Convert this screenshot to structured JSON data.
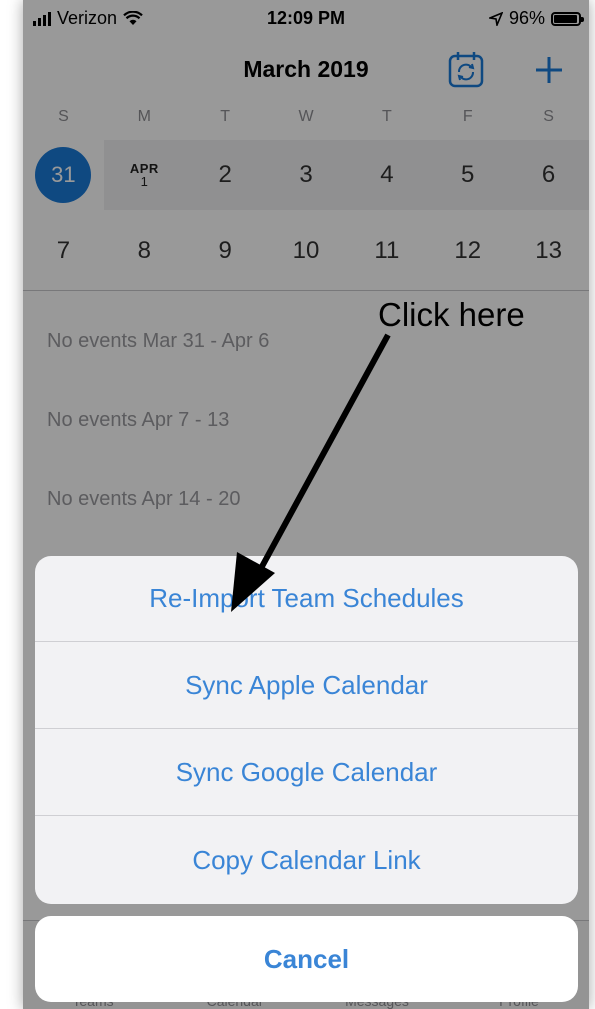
{
  "status_bar": {
    "carrier": "Verizon",
    "time": "12:09 PM",
    "battery": "96%",
    "battery_level": 0.96
  },
  "header": {
    "title": "March 2019",
    "calendar_sync_icon": "calendar-sync-icon",
    "add_icon": "plus-icon"
  },
  "weekdays": [
    "S",
    "M",
    "T",
    "W",
    "T",
    "F",
    "S"
  ],
  "week1": {
    "selected_day": "31",
    "apr_month": "APR",
    "apr_day": "1",
    "days": [
      "2",
      "3",
      "4",
      "5",
      "6"
    ]
  },
  "week2": [
    "7",
    "8",
    "9",
    "10",
    "11",
    "12",
    "13"
  ],
  "events": [
    "No events Mar 31 - Apr 6",
    "No events Apr 7 - 13",
    "No events Apr 14 - 20"
  ],
  "tabs": [
    "Teams",
    "Calendar",
    "Messages",
    "Profile"
  ],
  "action_sheet": {
    "options": [
      "Re-Import Team Schedules",
      "Sync Apple Calendar",
      "Sync Google Calendar",
      "Copy Calendar Link"
    ],
    "cancel": "Cancel"
  },
  "annotation": {
    "text": "Click here"
  },
  "colors": {
    "accent": "#3a85d6",
    "selected_day": "#1a7ad8"
  }
}
